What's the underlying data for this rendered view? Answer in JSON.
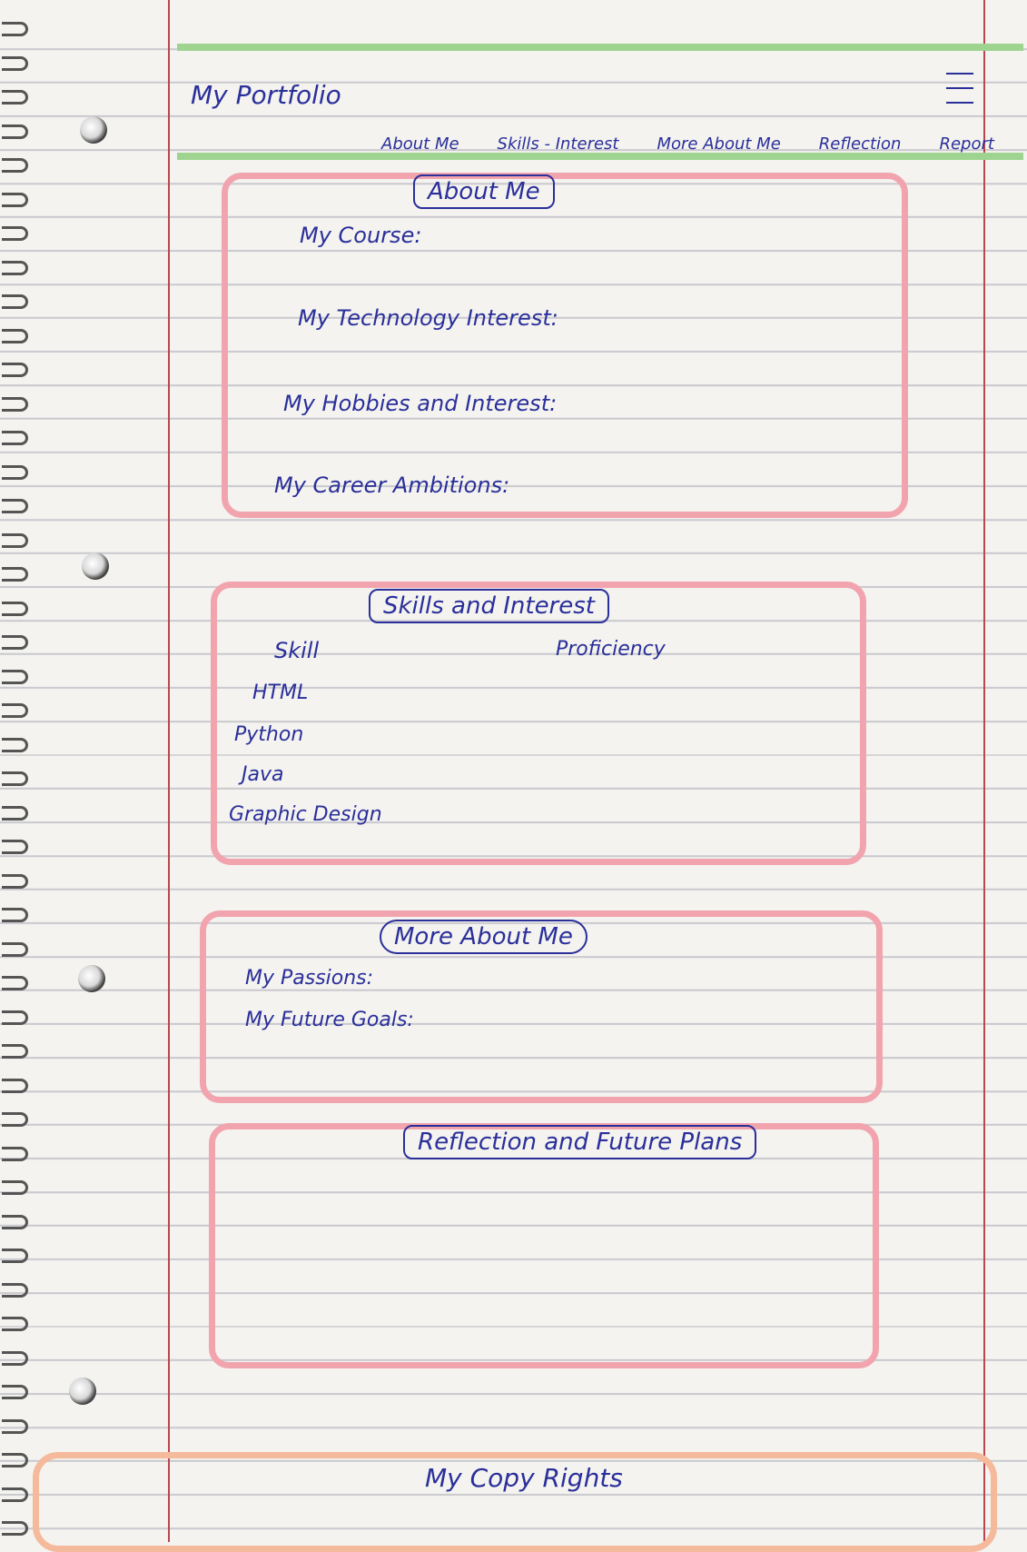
{
  "header": {
    "title": "My Portfolio"
  },
  "nav": {
    "items": [
      "About Me",
      "Skills - Interest",
      "More About Me",
      "Reflection",
      "Report"
    ]
  },
  "about": {
    "title": "About Me",
    "fields": [
      "My Course:",
      "My Technology Interest:",
      "My Hobbies and Interest:",
      "My Career Ambitions:"
    ]
  },
  "skills": {
    "title": "Skills and Interest",
    "header_skill": "Skill",
    "header_proficiency": "Proficiency",
    "items": [
      "HTML",
      "Python",
      "Java",
      "Graphic Design"
    ]
  },
  "more": {
    "title": "More About Me",
    "fields": [
      "My Passions:",
      "My Future Goals:"
    ]
  },
  "reflection": {
    "title": "Reflection and Future Plans"
  },
  "footer": {
    "text": "My Copy Rights"
  },
  "colors": {
    "ink": "#2a2f9a",
    "nav_band": "#9fd490",
    "section_border": "#f2a4ae",
    "footer_border": "#f5b99b",
    "margin_line": "#b8474f"
  },
  "icons": {
    "menu": "hamburger-menu-icon"
  }
}
